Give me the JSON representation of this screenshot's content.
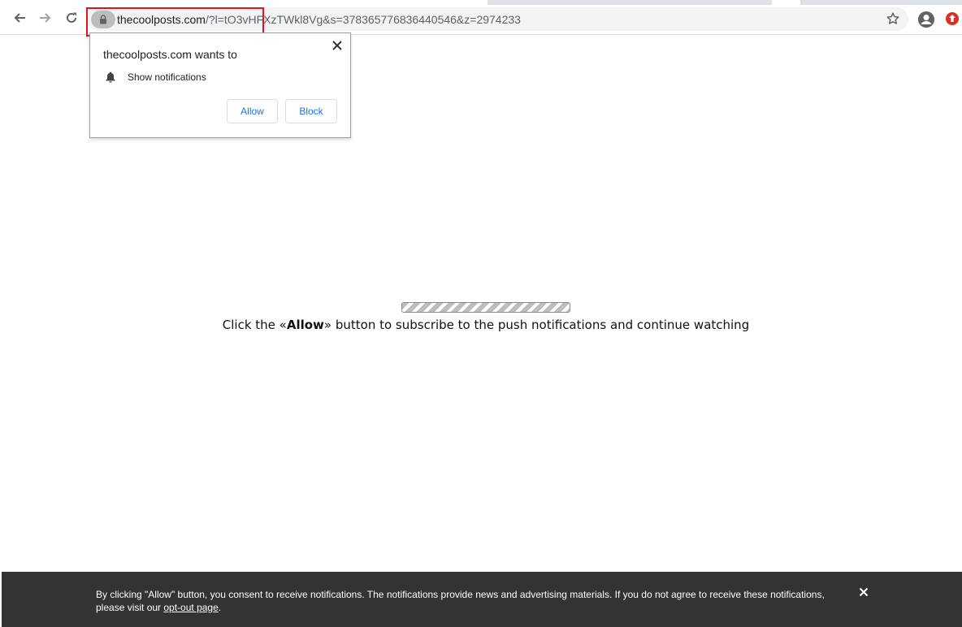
{
  "browser": {
    "url_host": "thecoolposts.com",
    "url_rest": "/?l=tO3vHFXzTWkl8Vg&s=378365776836440546&z=2974233"
  },
  "popup": {
    "title": "thecoolposts.com wants to",
    "permission": "Show notifications",
    "allow_label": "Allow",
    "block_label": "Block"
  },
  "page": {
    "progress": 0.0,
    "message_before": "Click the «",
    "message_bold": "Allow",
    "message_after": "» button to subscribe to the push notifications and continue watching"
  },
  "consent": {
    "text": "By clicking \"Allow\" button, you consent to receive notifications. The notifications provide news and advertising materials. If you do not agree to receive these notifications, please visit our ",
    "link": "opt-out page",
    "end": "."
  },
  "colors": {
    "highlight": "#e0141e",
    "link_blue": "#1a73e8",
    "consent_bg": "#333333",
    "extension_red": "#d93025"
  }
}
